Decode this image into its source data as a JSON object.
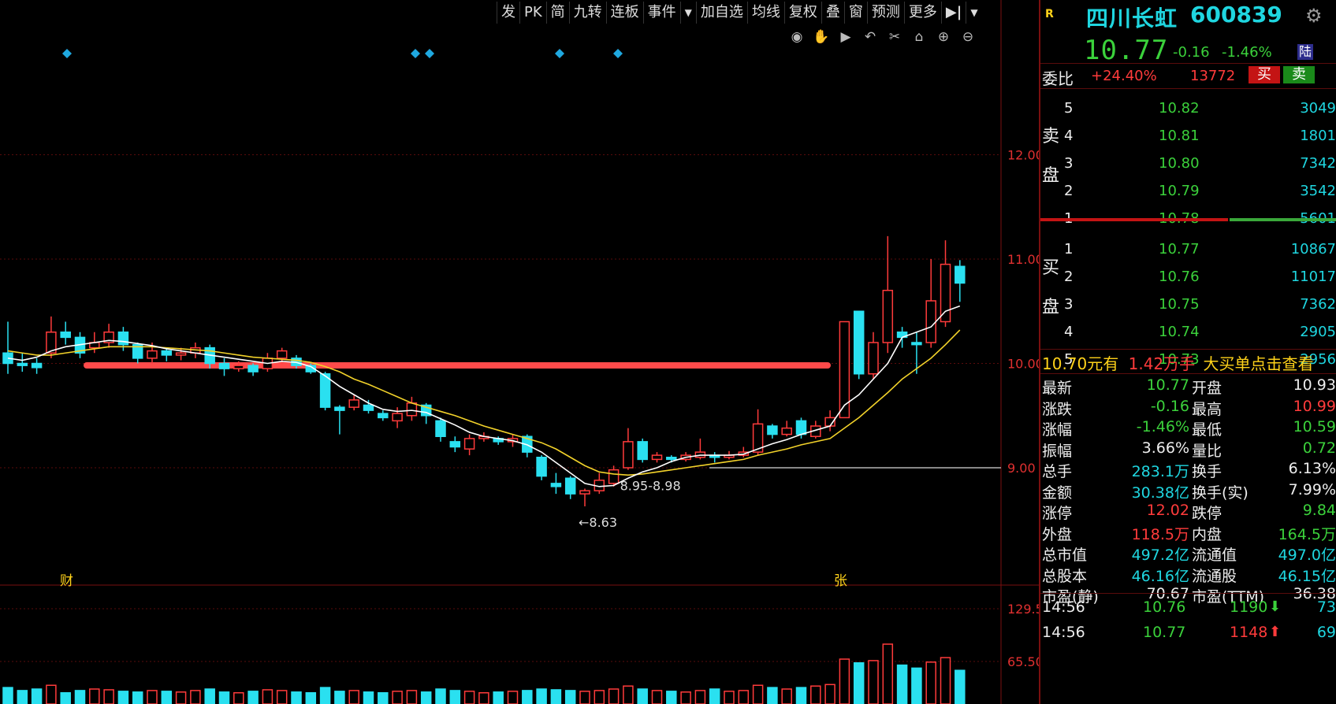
{
  "toolbar": {
    "items": [
      "发",
      "PK",
      "简",
      "九转",
      "连板",
      "事件",
      "加自选",
      "均线",
      "复权",
      "叠",
      "窗",
      "预测",
      "更多"
    ],
    "arrow_label": "▼",
    "side_icon": "▶|"
  },
  "chart_tools": [
    "eye-icon",
    "hand-icon",
    "play-icon",
    "undo-icon",
    "scissors-icon",
    "lock-icon",
    "zoom-in-icon",
    "zoom-out-icon"
  ],
  "chart_tool_glyphs": [
    "◉",
    "✋",
    "▶",
    "↶",
    "✂",
    "⌂",
    "⊕",
    "⊖"
  ],
  "kline": {
    "price_axis": [
      "12.00",
      "11.00",
      "10.00",
      "9.00"
    ],
    "volume_axis": [
      "129.5",
      "65.50"
    ],
    "annotations": {
      "low": "←8.63",
      "range": "8.95-8.98",
      "marker_cai": "财",
      "marker_zhang": "张"
    },
    "candles": [
      {
        "o": 10.1,
        "c": 10.0,
        "h": 10.4,
        "l": 9.9
      },
      {
        "o": 10.0,
        "c": 9.98,
        "h": 10.1,
        "l": 9.92
      },
      {
        "o": 10.0,
        "c": 9.96,
        "h": 10.05,
        "l": 9.9
      },
      {
        "o": 10.1,
        "c": 10.3,
        "h": 10.45,
        "l": 10.05
      },
      {
        "o": 10.3,
        "c": 10.25,
        "h": 10.4,
        "l": 10.18
      },
      {
        "o": 10.25,
        "c": 10.1,
        "h": 10.3,
        "l": 10.05
      },
      {
        "o": 10.15,
        "c": 10.2,
        "h": 10.3,
        "l": 10.1
      },
      {
        "o": 10.2,
        "c": 10.3,
        "h": 10.38,
        "l": 10.15
      },
      {
        "o": 10.3,
        "c": 10.18,
        "h": 10.35,
        "l": 10.12
      },
      {
        "o": 10.18,
        "c": 10.05,
        "h": 10.2,
        "l": 10.0
      },
      {
        "o": 10.05,
        "c": 10.12,
        "h": 10.2,
        "l": 10.0
      },
      {
        "o": 10.12,
        "c": 10.08,
        "h": 10.15,
        "l": 10.02
      },
      {
        "o": 10.08,
        "c": 10.1,
        "h": 10.15,
        "l": 10.03
      },
      {
        "o": 10.1,
        "c": 10.15,
        "h": 10.2,
        "l": 10.05
      },
      {
        "o": 10.15,
        "c": 10.0,
        "h": 10.18,
        "l": 9.95
      },
      {
        "o": 10.0,
        "c": 9.95,
        "h": 10.05,
        "l": 9.88
      },
      {
        "o": 9.95,
        "c": 9.98,
        "h": 10.02,
        "l": 9.92
      },
      {
        "o": 9.98,
        "c": 9.92,
        "h": 10.0,
        "l": 9.88
      },
      {
        "o": 9.95,
        "c": 10.05,
        "h": 10.1,
        "l": 9.92
      },
      {
        "o": 10.05,
        "c": 10.12,
        "h": 10.15,
        "l": 10.0
      },
      {
        "o": 10.05,
        "c": 9.98,
        "h": 10.08,
        "l": 9.95
      },
      {
        "o": 9.98,
        "c": 9.92,
        "h": 10.0,
        "l": 9.9
      },
      {
        "o": 9.9,
        "c": 9.58,
        "h": 9.92,
        "l": 9.55
      },
      {
        "o": 9.58,
        "c": 9.55,
        "h": 9.6,
        "l": 9.32
      },
      {
        "o": 9.58,
        "c": 9.65,
        "h": 9.7,
        "l": 9.55
      },
      {
        "o": 9.6,
        "c": 9.55,
        "h": 9.65,
        "l": 9.52
      },
      {
        "o": 9.52,
        "c": 9.48,
        "h": 9.55,
        "l": 9.45
      },
      {
        "o": 9.45,
        "c": 9.52,
        "h": 9.58,
        "l": 9.38
      },
      {
        "o": 9.5,
        "c": 9.62,
        "h": 9.68,
        "l": 9.45
      },
      {
        "o": 9.6,
        "c": 9.5,
        "h": 9.62,
        "l": 9.42
      },
      {
        "o": 9.45,
        "c": 9.3,
        "h": 9.48,
        "l": 9.25
      },
      {
        "o": 9.25,
        "c": 9.2,
        "h": 9.3,
        "l": 9.15
      },
      {
        "o": 9.18,
        "c": 9.28,
        "h": 9.32,
        "l": 9.12
      },
      {
        "o": 9.28,
        "c": 9.3,
        "h": 9.34,
        "l": 9.25
      },
      {
        "o": 9.28,
        "c": 9.25,
        "h": 9.3,
        "l": 9.22
      },
      {
        "o": 9.25,
        "c": 9.28,
        "h": 9.32,
        "l": 9.2
      },
      {
        "o": 9.3,
        "c": 9.15,
        "h": 9.32,
        "l": 9.1
      },
      {
        "o": 9.1,
        "c": 8.92,
        "h": 9.12,
        "l": 8.88
      },
      {
        "o": 8.85,
        "c": 8.82,
        "h": 8.95,
        "l": 8.75
      },
      {
        "o": 8.9,
        "c": 8.75,
        "h": 8.92,
        "l": 8.7
      },
      {
        "o": 8.75,
        "c": 8.78,
        "h": 8.8,
        "l": 8.63
      },
      {
        "o": 8.78,
        "c": 8.88,
        "h": 8.95,
        "l": 8.75
      },
      {
        "o": 8.85,
        "c": 8.98,
        "h": 9.02,
        "l": 8.82
      },
      {
        "o": 9.0,
        "c": 9.25,
        "h": 9.38,
        "l": 8.98
      },
      {
        "o": 9.25,
        "c": 9.08,
        "h": 9.28,
        "l": 9.05
      },
      {
        "o": 9.08,
        "c": 9.12,
        "h": 9.15,
        "l": 9.05
      },
      {
        "o": 9.1,
        "c": 9.08,
        "h": 9.12,
        "l": 9.05
      },
      {
        "o": 9.08,
        "c": 9.12,
        "h": 9.15,
        "l": 9.06
      },
      {
        "o": 9.1,
        "c": 9.15,
        "h": 9.28,
        "l": 9.08
      },
      {
        "o": 9.12,
        "c": 9.1,
        "h": 9.15,
        "l": 9.05
      },
      {
        "o": 9.1,
        "c": 9.12,
        "h": 9.16,
        "l": 9.08
      },
      {
        "o": 9.12,
        "c": 9.15,
        "h": 9.2,
        "l": 9.1
      },
      {
        "o": 9.15,
        "c": 9.42,
        "h": 9.56,
        "l": 9.12
      },
      {
        "o": 9.4,
        "c": 9.32,
        "h": 9.42,
        "l": 9.28
      },
      {
        "o": 9.32,
        "c": 9.38,
        "h": 9.45,
        "l": 9.3
      },
      {
        "o": 9.45,
        "c": 9.32,
        "h": 9.48,
        "l": 9.28
      },
      {
        "o": 9.3,
        "c": 9.4,
        "h": 9.45,
        "l": 9.28
      },
      {
        "o": 9.4,
        "c": 9.48,
        "h": 9.55,
        "l": 9.35
      },
      {
        "o": 9.48,
        "c": 10.4,
        "h": 10.4,
        "l": 9.48
      },
      {
        "o": 10.5,
        "c": 9.9,
        "h": 10.5,
        "l": 9.85
      },
      {
        "o": 9.9,
        "c": 10.2,
        "h": 10.3,
        "l": 9.85
      },
      {
        "o": 10.2,
        "c": 10.7,
        "h": 11.22,
        "l": 10.1
      },
      {
        "o": 10.3,
        "c": 10.25,
        "h": 10.35,
        "l": 10.15
      },
      {
        "o": 10.2,
        "c": 10.18,
        "h": 10.3,
        "l": 9.9
      },
      {
        "o": 10.2,
        "c": 10.6,
        "h": 11.0,
        "l": 10.15
      },
      {
        "o": 10.4,
        "c": 10.95,
        "h": 11.18,
        "l": 10.35
      },
      {
        "o": 10.93,
        "c": 10.77,
        "h": 10.99,
        "l": 10.59
      }
    ],
    "ma5": [
      10.05,
      10.03,
      10.06,
      10.12,
      10.16,
      10.18,
      10.2,
      10.22,
      10.21,
      10.19,
      10.17,
      10.14,
      10.12,
      10.1,
      10.08,
      10.06,
      10.04,
      10.02,
      10.0,
      10.02,
      10.01,
      9.97,
      9.88,
      9.78,
      9.7,
      9.62,
      9.56,
      9.54,
      9.55,
      9.53,
      9.47,
      9.41,
      9.34,
      9.3,
      9.28,
      9.26,
      9.22,
      9.15,
      9.05,
      8.95,
      8.85,
      8.82,
      8.83,
      8.9,
      8.96,
      9.0,
      9.06,
      9.1,
      9.12,
      9.12,
      9.12,
      9.13,
      9.18,
      9.23,
      9.27,
      9.32,
      9.36,
      9.4,
      9.6,
      9.7,
      9.85,
      10.0,
      10.25,
      10.3,
      10.35,
      10.5,
      10.55
    ],
    "ma10": [
      10.12,
      10.1,
      10.08,
      10.08,
      10.1,
      10.12,
      10.14,
      10.16,
      10.16,
      10.16,
      10.16,
      10.15,
      10.14,
      10.13,
      10.12,
      10.1,
      10.08,
      10.06,
      10.05,
      10.04,
      10.03,
      10.01,
      9.97,
      9.92,
      9.85,
      9.8,
      9.74,
      9.68,
      9.62,
      9.58,
      9.54,
      9.5,
      9.45,
      9.4,
      9.36,
      9.32,
      9.28,
      9.24,
      9.18,
      9.1,
      9.02,
      8.96,
      8.94,
      8.93,
      8.94,
      8.96,
      8.98,
      9.0,
      9.02,
      9.04,
      9.06,
      9.08,
      9.12,
      9.15,
      9.18,
      9.22,
      9.25,
      9.28,
      9.38,
      9.48,
      9.6,
      9.72,
      9.85,
      9.95,
      10.05,
      10.18,
      10.32
    ],
    "volumes": [
      22,
      18,
      20,
      25,
      15,
      18,
      20,
      19,
      17,
      16,
      18,
      17,
      16,
      18,
      20,
      16,
      15,
      17,
      19,
      18,
      16,
      15,
      22,
      17,
      18,
      16,
      15,
      17,
      18,
      16,
      20,
      18,
      17,
      15,
      16,
      17,
      18,
      20,
      19,
      18,
      17,
      18,
      20,
      24,
      20,
      18,
      17,
      16,
      18,
      20,
      17,
      18,
      25,
      22,
      20,
      22,
      24,
      26,
      60,
      55,
      58,
      80,
      52,
      48,
      56,
      62,
      45
    ]
  },
  "stock": {
    "badge": "R",
    "name": "四川长虹",
    "code": "600839",
    "price": "10.77",
    "change": "-0.16",
    "change_pct": "-1.46%",
    "lu_tag": "陆"
  },
  "weibi": {
    "label": "委比",
    "pct": "+24.40%",
    "diff": "13772",
    "buy_btn": "买",
    "sell_btn": "卖"
  },
  "sell_label": [
    "卖",
    "盘"
  ],
  "buy_label": [
    "买",
    "盘"
  ],
  "sell_orders": [
    {
      "lvl": "5",
      "price": "10.82",
      "vol": "3049"
    },
    {
      "lvl": "4",
      "price": "10.81",
      "vol": "1801"
    },
    {
      "lvl": "3",
      "price": "10.80",
      "vol": "7342"
    },
    {
      "lvl": "2",
      "price": "10.79",
      "vol": "3542"
    },
    {
      "lvl": "1",
      "price": "10.78",
      "vol": "5601"
    }
  ],
  "buy_orders": [
    {
      "lvl": "1",
      "price": "10.77",
      "vol": "10867"
    },
    {
      "lvl": "2",
      "price": "10.76",
      "vol": "11017"
    },
    {
      "lvl": "3",
      "price": "10.75",
      "vol": "7362"
    },
    {
      "lvl": "4",
      "price": "10.74",
      "vol": "2905"
    },
    {
      "lvl": "5",
      "price": "10.73",
      "vol": "2956"
    }
  ],
  "big_order": {
    "price": "10.70",
    "unit": "元有",
    "amount": "1.42万手",
    "link": "大买单点击查看"
  },
  "stats": [
    {
      "k1": "最新",
      "v1": "10.77",
      "c1": "green",
      "k2": "开盘",
      "v2": "10.93",
      "c2": "white"
    },
    {
      "k1": "涨跌",
      "v1": "-0.16",
      "c1": "green",
      "k2": "最高",
      "v2": "10.99",
      "c2": "red"
    },
    {
      "k1": "涨幅",
      "v1": "-1.46%",
      "c1": "green",
      "k2": "最低",
      "v2": "10.59",
      "c2": "green"
    },
    {
      "k1": "振幅",
      "v1": "3.66%",
      "c1": "white",
      "k2": "量比",
      "v2": "0.72",
      "c2": "green"
    },
    {
      "k1": "总手",
      "v1": "283.1万",
      "c1": "cyan",
      "k2": "换手",
      "v2": "6.13%",
      "c2": "white"
    },
    {
      "k1": "金额",
      "v1": "30.38亿",
      "c1": "cyan",
      "k2": "换手(实)",
      "v2": "7.99%",
      "c2": "white"
    },
    {
      "k1": "涨停",
      "v1": "12.02",
      "c1": "red",
      "k2": "跌停",
      "v2": "9.84",
      "c2": "green"
    },
    {
      "k1": "外盘",
      "v1": "118.5万",
      "c1": "red",
      "k2": "内盘",
      "v2": "164.5万",
      "c2": "green"
    },
    {
      "k1": "总市值",
      "v1": "497.2亿",
      "c1": "cyan",
      "k2": "流通值",
      "v2": "497.0亿",
      "c2": "cyan"
    },
    {
      "k1": "总股本",
      "v1": "46.16亿",
      "c1": "cyan",
      "k2": "流通股",
      "v2": "46.15亿",
      "c2": "cyan"
    },
    {
      "k1": "市盈(静)",
      "v1": "70.67",
      "c1": "white",
      "k2": "市盈(TTM)",
      "v2": "36.38",
      "c2": "white"
    }
  ],
  "ticks": [
    {
      "time": "14:56",
      "price": "10.76",
      "vol": "1190",
      "dir": "down",
      "n": "73"
    },
    {
      "time": "14:56",
      "price": "10.77",
      "vol": "1148",
      "dir": "up",
      "n": "69"
    }
  ]
}
